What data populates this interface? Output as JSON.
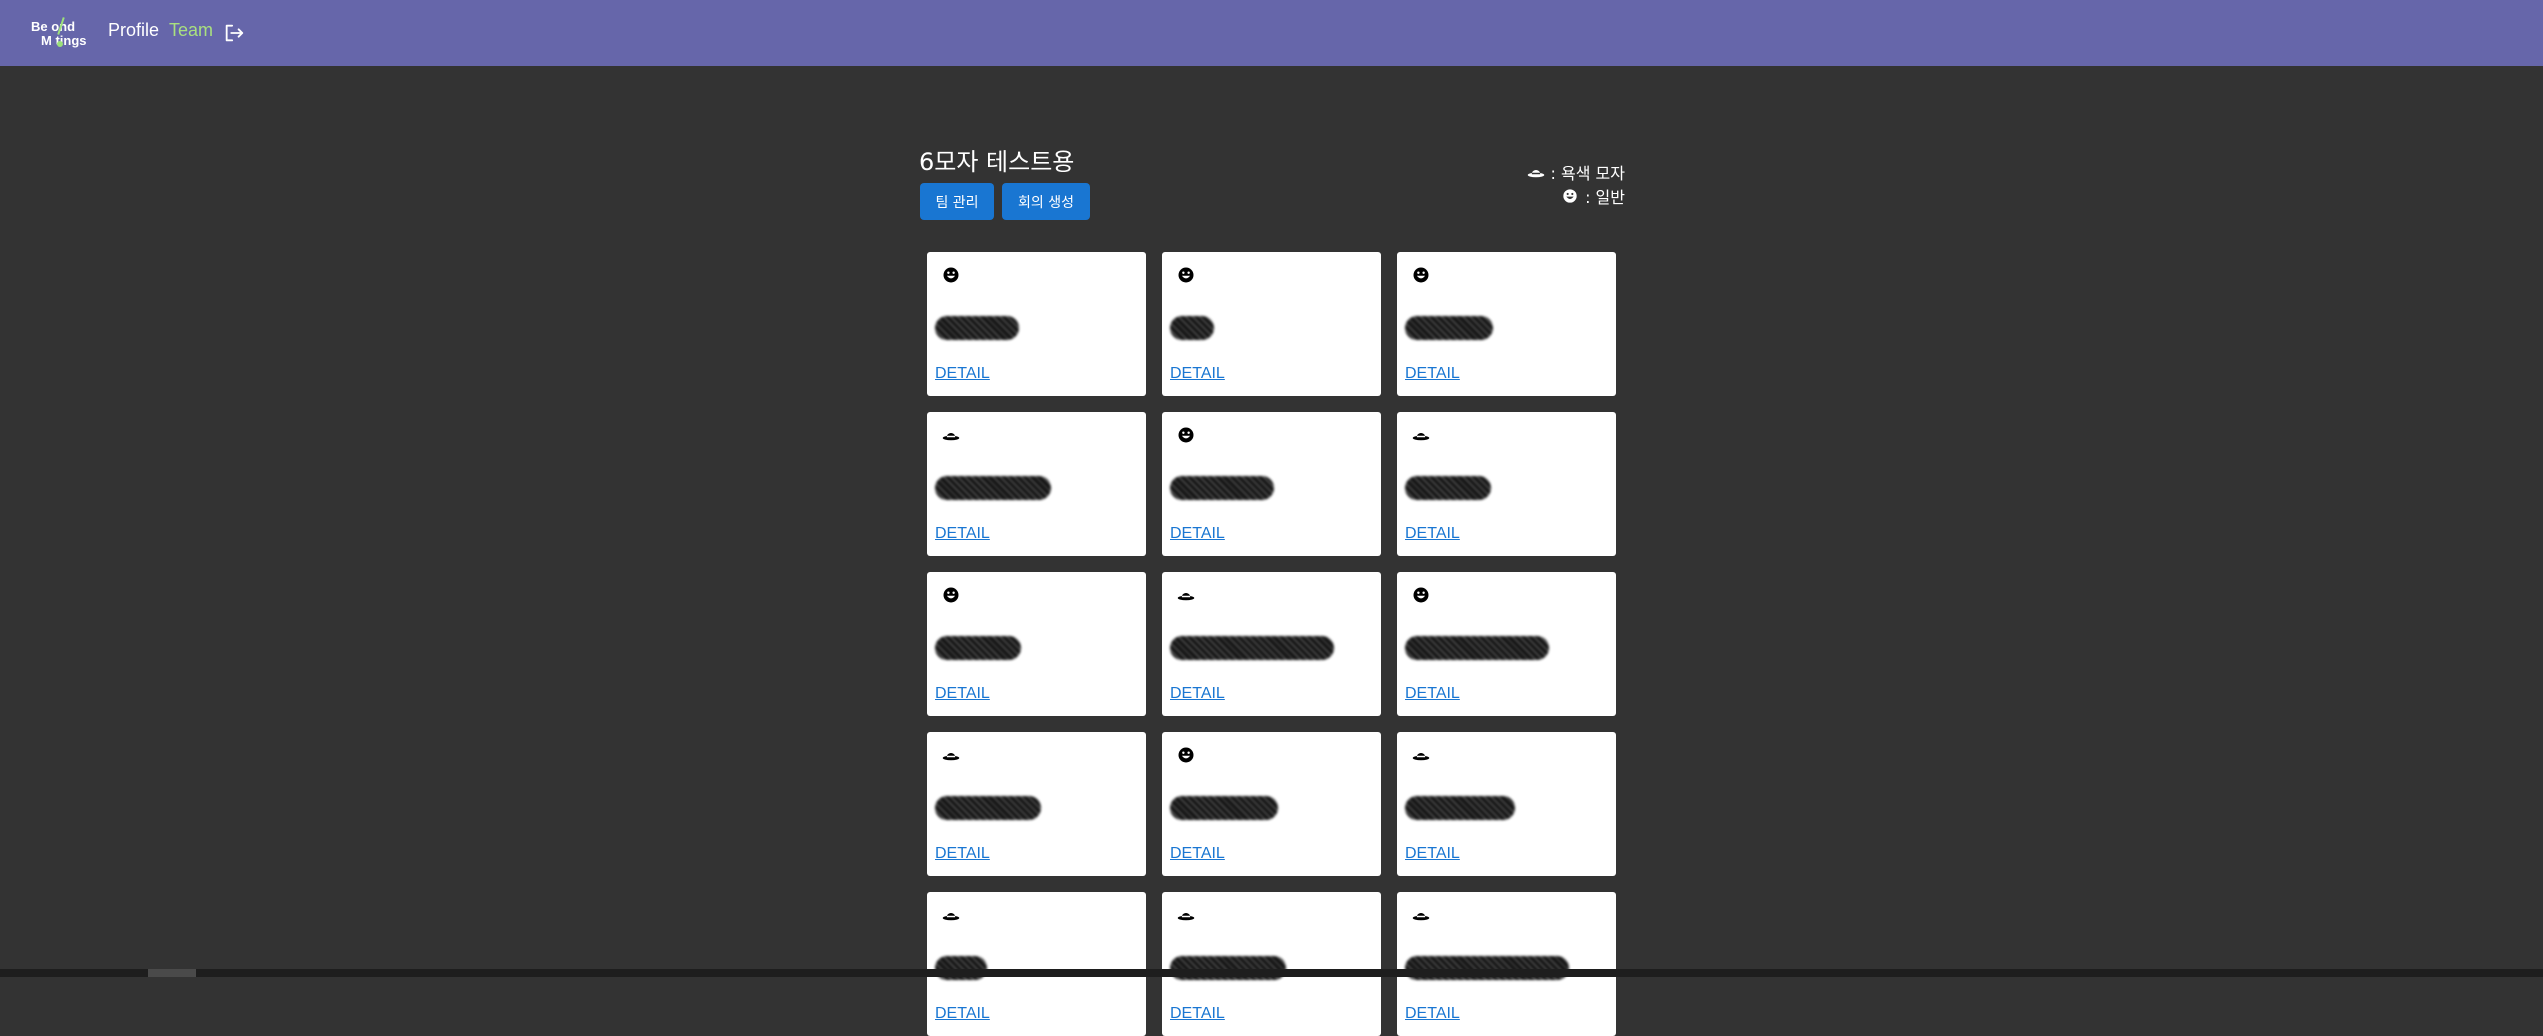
{
  "header": {
    "logo_line1": "Be  ond",
    "logo_line2": "M  tings",
    "nav": [
      {
        "label": "Profile"
      },
      {
        "label": "Team"
      }
    ],
    "logout_icon": "logout-icon"
  },
  "team": {
    "title": "6모자 테스트용",
    "buttons": {
      "manage": "팀 관리",
      "create_meeting": "회의 생성"
    }
  },
  "legend": {
    "brown_hat": {
      "icon": "bowler-hat-icon",
      "label": ": 욕색 모자"
    },
    "normal": {
      "icon": "smiley-icon",
      "label": ": 일반"
    }
  },
  "cards": [
    {
      "icon": "smiley-icon",
      "redaction": 0.42,
      "link": "DETAIL"
    },
    {
      "icon": "smiley-icon",
      "redaction": 0.22,
      "link": "DETAIL"
    },
    {
      "icon": "smiley-icon",
      "redaction": 0.44,
      "link": "DETAIL"
    },
    {
      "icon": "bowler-hat-icon",
      "redaction": 0.58,
      "link": "DETAIL"
    },
    {
      "icon": "smiley-icon",
      "redaction": 0.52,
      "link": "DETAIL"
    },
    {
      "icon": "bowler-hat-icon",
      "redaction": 0.43,
      "link": "DETAIL"
    },
    {
      "icon": "smiley-icon",
      "redaction": 0.43,
      "link": "DETAIL"
    },
    {
      "icon": "bowler-hat-icon",
      "redaction": 0.82,
      "link": "DETAIL"
    },
    {
      "icon": "smiley-icon",
      "redaction": 0.72,
      "link": "DETAIL"
    },
    {
      "icon": "bowler-hat-icon",
      "redaction": 0.53,
      "link": "DETAIL"
    },
    {
      "icon": "smiley-icon",
      "redaction": 0.54,
      "link": "DETAIL"
    },
    {
      "icon": "bowler-hat-icon",
      "redaction": 0.55,
      "link": "DETAIL"
    },
    {
      "icon": "bowler-hat-icon",
      "redaction": 0.26,
      "link": "DETAIL"
    },
    {
      "icon": "bowler-hat-icon",
      "redaction": 0.58,
      "link": "DETAIL"
    },
    {
      "icon": "bowler-hat-icon",
      "redaction": 0.82,
      "link": "DETAIL"
    }
  ],
  "colors": {
    "navbar": "#6666aa",
    "background": "#333333",
    "accent_green": "#a9e07f",
    "primary_blue": "#1976d2"
  }
}
